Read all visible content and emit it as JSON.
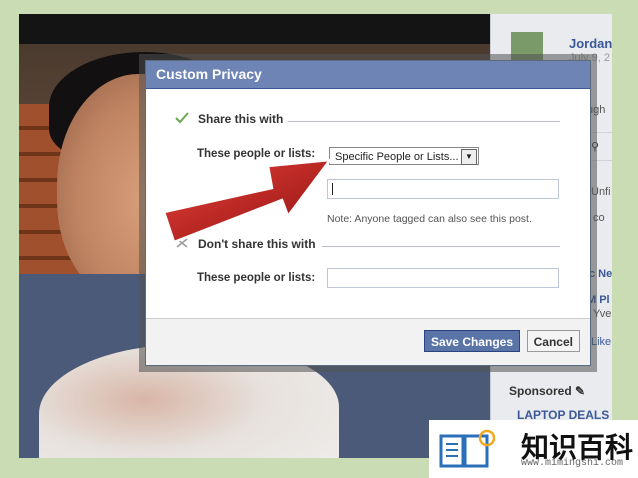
{
  "facebook": {
    "name": "Jordan",
    "date": "July 9, 2",
    "fragments": [
      "ugh",
      "Unfi",
      "co",
      "c New",
      "M Pl",
      "Yve",
      "Like"
    ],
    "sponsored_label": "Sponsored",
    "ad_title": "LAPTOP DEALS In"
  },
  "dialog": {
    "title": "Custom Privacy",
    "share_section": "Share this with",
    "share_label": "These people or lists:",
    "share_select": "Specific People or Lists...",
    "note": "Note: Anyone tagged can also see this post.",
    "dont_share_section": "Don't share this with",
    "dont_share_label": "These people or lists:",
    "save_button": "Save Changes",
    "cancel_button": "Cancel"
  },
  "watermark": {
    "title": "知识百科",
    "url": "www.mimingshi.com"
  },
  "colors": {
    "header": "#6d84b4",
    "save_button": "#5b74a8",
    "arrow": "#c0201c"
  }
}
